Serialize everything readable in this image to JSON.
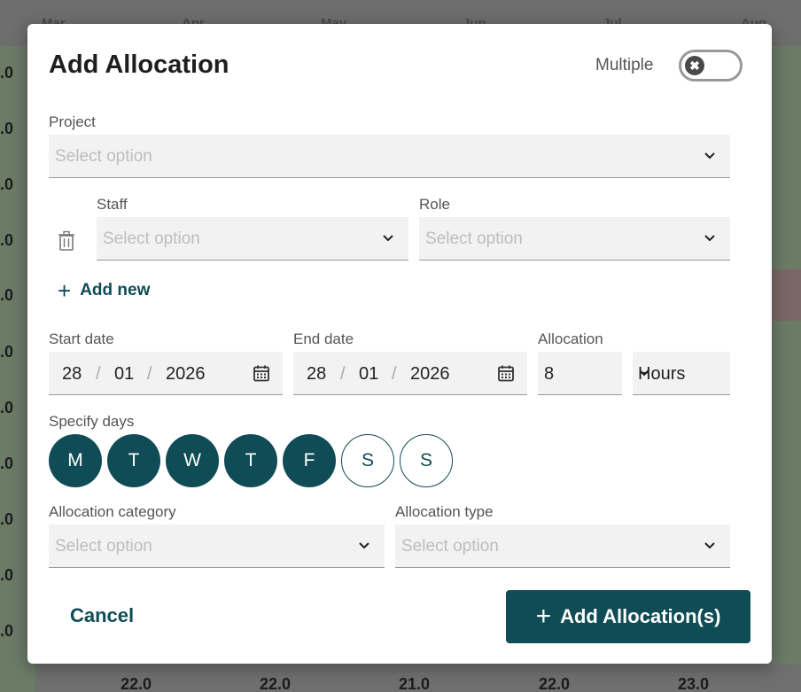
{
  "background": {
    "months": [
      "Mar",
      "Apr",
      "May",
      "Jun",
      "Jul",
      "Aug"
    ],
    "left_cells": [
      ".0",
      ".0",
      ".0",
      ".0",
      ".0",
      ".0",
      ".0",
      ".0",
      ".0",
      ".0",
      ".0"
    ],
    "totals": [
      "22.0",
      "22.0",
      "21.0",
      "22.0",
      "23.0"
    ]
  },
  "modal": {
    "title": "Add Allocation",
    "multiple_label": "Multiple",
    "toggle_icon": "✖",
    "project": {
      "label": "Project",
      "placeholder": "Select option"
    },
    "staff": {
      "label": "Staff",
      "placeholder": "Select option"
    },
    "role": {
      "label": "Role",
      "placeholder": "Select option"
    },
    "add_new": {
      "icon": "+",
      "label": "Add new"
    },
    "start_date": {
      "label": "Start date",
      "day": "28",
      "month": "01",
      "year": "2026"
    },
    "end_date": {
      "label": "End date",
      "day": "28",
      "month": "01",
      "year": "2026"
    },
    "date_sep": "/",
    "allocation": {
      "label": "Allocation",
      "value": "8",
      "unit": "Hours"
    },
    "specify_days": {
      "label": "Specify days",
      "days": [
        {
          "letter": "M",
          "selected": true
        },
        {
          "letter": "T",
          "selected": true
        },
        {
          "letter": "W",
          "selected": true
        },
        {
          "letter": "T",
          "selected": true
        },
        {
          "letter": "F",
          "selected": true
        },
        {
          "letter": "S",
          "selected": false
        },
        {
          "letter": "S",
          "selected": false
        }
      ]
    },
    "allocation_category": {
      "label": "Allocation category",
      "placeholder": "Select option"
    },
    "allocation_type": {
      "label": "Allocation type",
      "placeholder": "Select option"
    },
    "cancel_label": "Cancel",
    "submit": {
      "icon": "+",
      "label": "Add Allocation(s)"
    }
  },
  "colors": {
    "accent": "#0f4c55",
    "field_bg": "#f2f2f2",
    "placeholder": "#bdbdbd"
  }
}
